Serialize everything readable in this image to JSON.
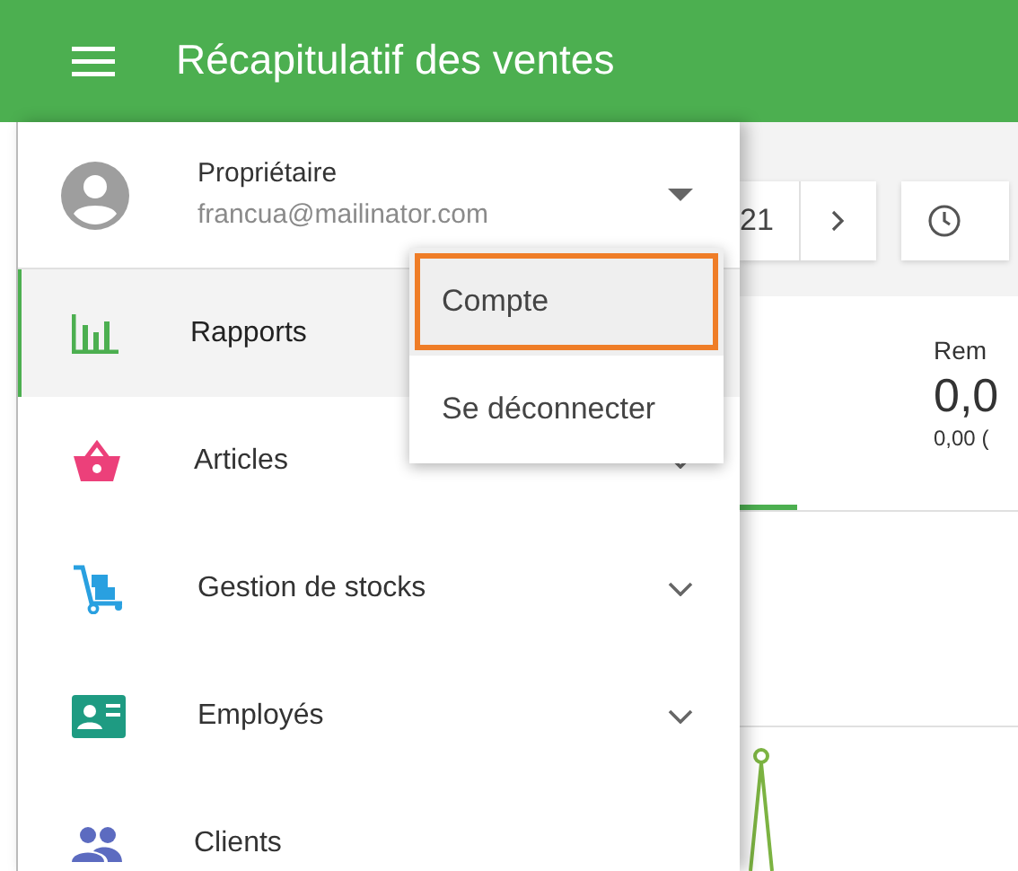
{
  "app_bar": {
    "title": "Récapitulatif des ventes"
  },
  "account": {
    "name": "Propriétaire",
    "email": "francua@mailinator.com",
    "expanded": true
  },
  "account_menu": [
    {
      "label": "Compte",
      "highlighted": true
    },
    {
      "label": "Se déconnecter",
      "highlighted": false
    }
  ],
  "drawer_items": [
    {
      "label": "Rapports",
      "selected": true,
      "expandable": false
    },
    {
      "label": "Articles",
      "selected": false,
      "expandable": true
    },
    {
      "label": "Gestion de stocks",
      "selected": false,
      "expandable": true
    },
    {
      "label": "Employés",
      "selected": false,
      "expandable": true
    },
    {
      "label": "Clients",
      "selected": false,
      "expandable": false
    }
  ],
  "background": {
    "date_text": "21",
    "card_label": "Rem",
    "card_value": "0,0",
    "card_sub": "0,00 ("
  }
}
